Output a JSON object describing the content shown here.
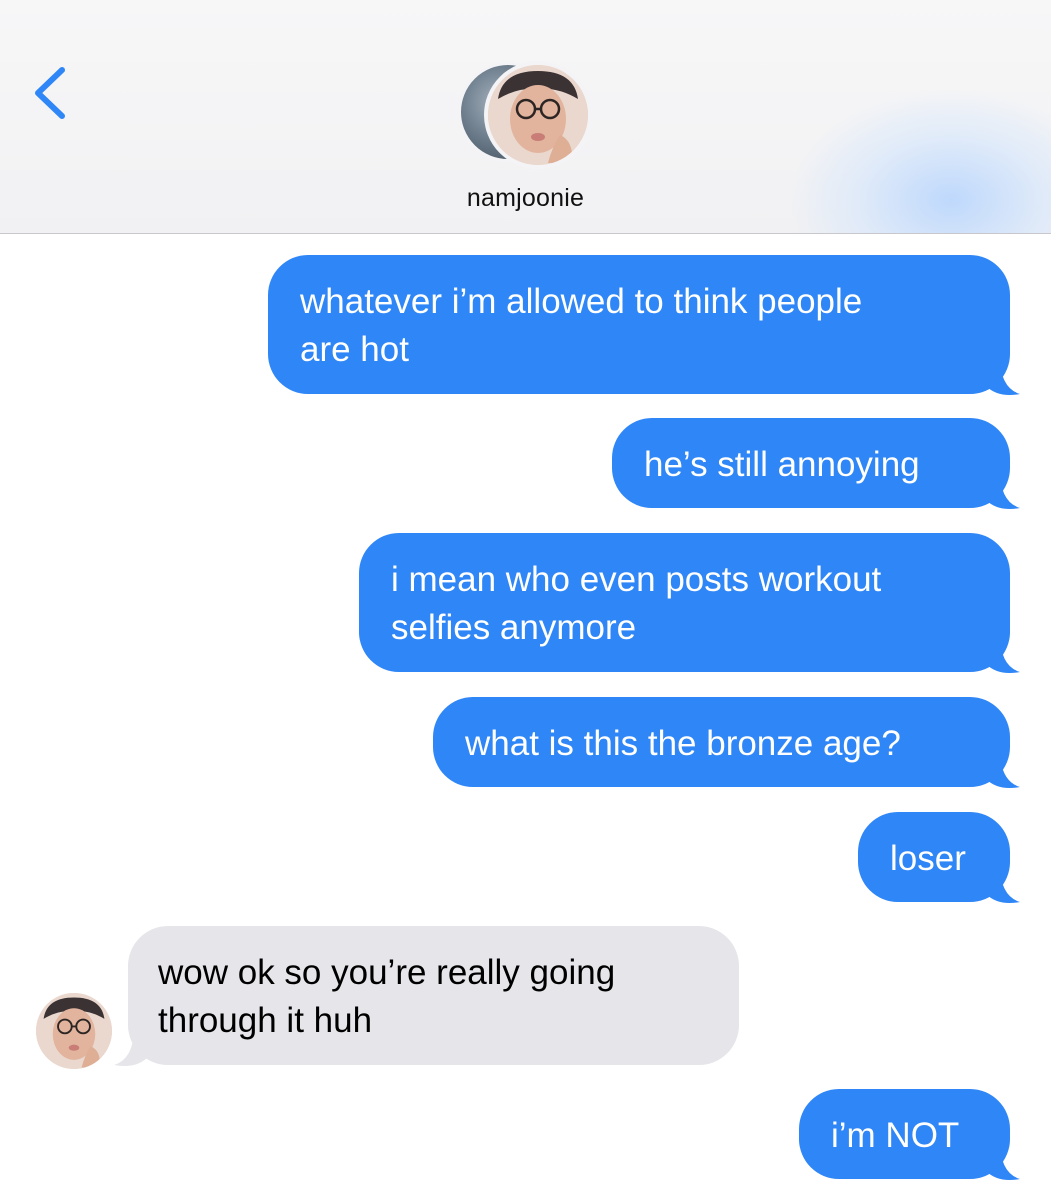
{
  "header": {
    "contact_name": "namjoonie",
    "back_icon": "chevron-left-icon",
    "accent_color": "#2f86f6"
  },
  "colors": {
    "sent_bubble": "#2f86f6",
    "received_bubble": "#e5e5ea"
  },
  "messages": [
    {
      "direction": "sent",
      "lines": [
        "whatever i’m allowed to think people",
        "are hot"
      ]
    },
    {
      "direction": "sent",
      "lines": [
        "he’s still annoying"
      ]
    },
    {
      "direction": "sent",
      "lines": [
        "i mean who even posts workout",
        "selfies anymore"
      ]
    },
    {
      "direction": "sent",
      "lines": [
        "what is this the bronze age?"
      ]
    },
    {
      "direction": "sent",
      "lines": [
        "loser"
      ]
    },
    {
      "direction": "received",
      "lines": [
        "wow ok so you’re really going",
        "through it huh"
      ]
    },
    {
      "direction": "sent",
      "lines": [
        "i’m NOT"
      ]
    }
  ]
}
